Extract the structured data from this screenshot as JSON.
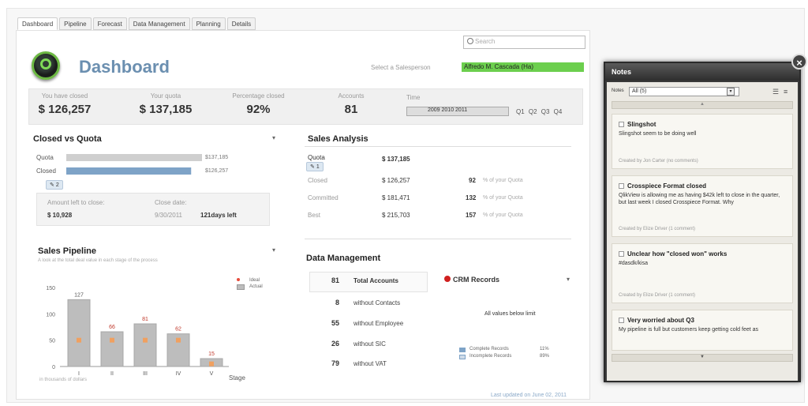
{
  "tabs": [
    "Dashboard",
    "Pipeline",
    "Forecast",
    "Data Management",
    "Planning",
    "Details"
  ],
  "search": {
    "placeholder": "Search"
  },
  "header": {
    "title": "Dashboard",
    "salesperson_label": "Select a Salesperson",
    "salesperson_value": "Alfredo M. Cascada (Ha)"
  },
  "kpis": [
    {
      "label": "You have closed",
      "value": "$ 126,257"
    },
    {
      "label": "Your quota",
      "value": "$ 137,185"
    },
    {
      "label": "Percentage closed",
      "value": "92%"
    },
    {
      "label": "Accounts",
      "value": "81"
    }
  ],
  "time": {
    "label": "Time",
    "years": "2009 2010 2011",
    "quarters": "Q1 Q2 Q3 Q4"
  },
  "closed_vs_quota": {
    "title": "Closed vs Quota",
    "rows": [
      {
        "label": "Quota",
        "value": "$137,185",
        "fraction": 1.0
      },
      {
        "label": "Closed",
        "value": "$126,257",
        "fraction": 0.92
      }
    ],
    "note_count": "2",
    "amount_left_label": "Amount left to close:",
    "amount_left_value": "$ 10,928",
    "close_date_label": "Close date:",
    "close_date_value": "9/30/2011",
    "days_left": "121days left"
  },
  "sales_analysis": {
    "title": "Sales Analysis",
    "rows": [
      {
        "label": "Quota",
        "value": "$ 137,185",
        "num": "",
        "pct": ""
      },
      {
        "label": "Closed",
        "value": "$ 126,257",
        "num": "92",
        "pct": "% of your Quota"
      },
      {
        "label": "Committed",
        "value": "$ 181,471",
        "num": "132",
        "pct": "% of your Quota"
      },
      {
        "label": "Best",
        "value": "$ 215,703",
        "num": "157",
        "pct": "% of your Quota"
      }
    ],
    "note_count": "1"
  },
  "sales_pipeline": {
    "title": "Sales Pipeline",
    "subtitle": "A look at the total deal value in each stage of the process",
    "legend": [
      "Ideal",
      "Actual"
    ],
    "xlabel": "Stage",
    "footnote": "in thousands of dollars"
  },
  "chart_data": {
    "type": "bar",
    "categories": [
      "I",
      "II",
      "III",
      "IV",
      "V"
    ],
    "series": [
      {
        "name": "Actual",
        "values": [
          127,
          66,
          81,
          62,
          15
        ]
      },
      {
        "name": "Ideal",
        "values": [
          50,
          50,
          50,
          50,
          5
        ]
      }
    ],
    "yticks": [
      0,
      50,
      100,
      150
    ],
    "ylim": [
      0,
      150
    ],
    "xlabel": "Stage",
    "colors": {
      "actual": "#bdbdbd",
      "ideal": "#f0a060",
      "labels": "#c0392b"
    }
  },
  "data_management": {
    "title": "Data Management",
    "rows": [
      {
        "num": "81",
        "label": "Total Accounts"
      },
      {
        "num": "8",
        "label": "without Contacts"
      },
      {
        "num": "55",
        "label": "without Employee"
      },
      {
        "num": "26",
        "label": "without SIC"
      },
      {
        "num": "79",
        "label": "without VAT"
      }
    ],
    "crm_title": "CRM Records",
    "crm_message": "All values below limit",
    "crm_legend": [
      {
        "label": "Complete Records",
        "value": "11%"
      },
      {
        "label": "Incomplete Records",
        "value": "89%"
      }
    ]
  },
  "notes": {
    "title": "Notes",
    "filter_label": "Notes",
    "filter_value": "All (5)",
    "items": [
      {
        "title": "Slingshot",
        "text": "Slingshot seem to be doing well",
        "meta": "Created by Jon Carter (no comments)"
      },
      {
        "title": "Crosspiece Format closed",
        "text": "QlikView is allowing me as having $42k left to close in the quarter, but last week I closed Crosspiece Format. Why",
        "meta": "Created by Elize Driver (1 comment)"
      },
      {
        "title": "Unclear how \"closed won\" works",
        "text": "#dasdk/kisa",
        "meta": "Created by Elize Driver (1 comment)"
      },
      {
        "title": "Very worried about Q3",
        "text": "My pipeline is full but customers keep getting cold feet as",
        "meta": ""
      }
    ]
  },
  "footer": "Last updated on June 02, 2011"
}
